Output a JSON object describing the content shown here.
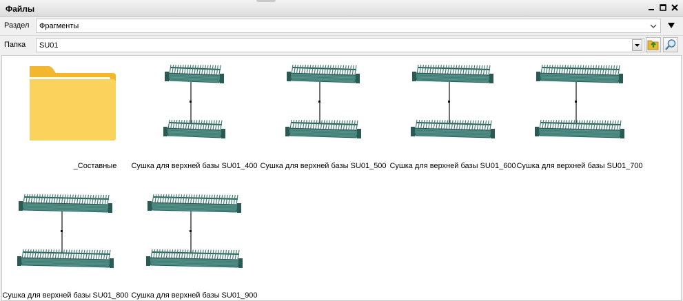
{
  "window": {
    "title": "Файлы"
  },
  "section": {
    "label": "Раздел",
    "value": "Фрагменты"
  },
  "folder": {
    "label": "Папка",
    "value": "SU01"
  },
  "items": [
    {
      "name": "_Составные",
      "type": "folder"
    },
    {
      "name": "Сушка для верхней базы SU01_400",
      "type": "fragment"
    },
    {
      "name": "Сушка для верхней базы SU01_500",
      "type": "fragment"
    },
    {
      "name": "Сушка для верхней базы SU01_600",
      "type": "fragment"
    },
    {
      "name": "Сушка для верхней базы SU01_700",
      "type": "fragment"
    },
    {
      "name": "Сушка для верхней базы SU01_800",
      "type": "fragment"
    },
    {
      "name": "Сушка для верхней базы SU01_900",
      "type": "fragment"
    }
  ],
  "colors": {
    "rack": "#3f7d75",
    "rack_dark": "#2b5a55",
    "folder": "#f6c543"
  }
}
